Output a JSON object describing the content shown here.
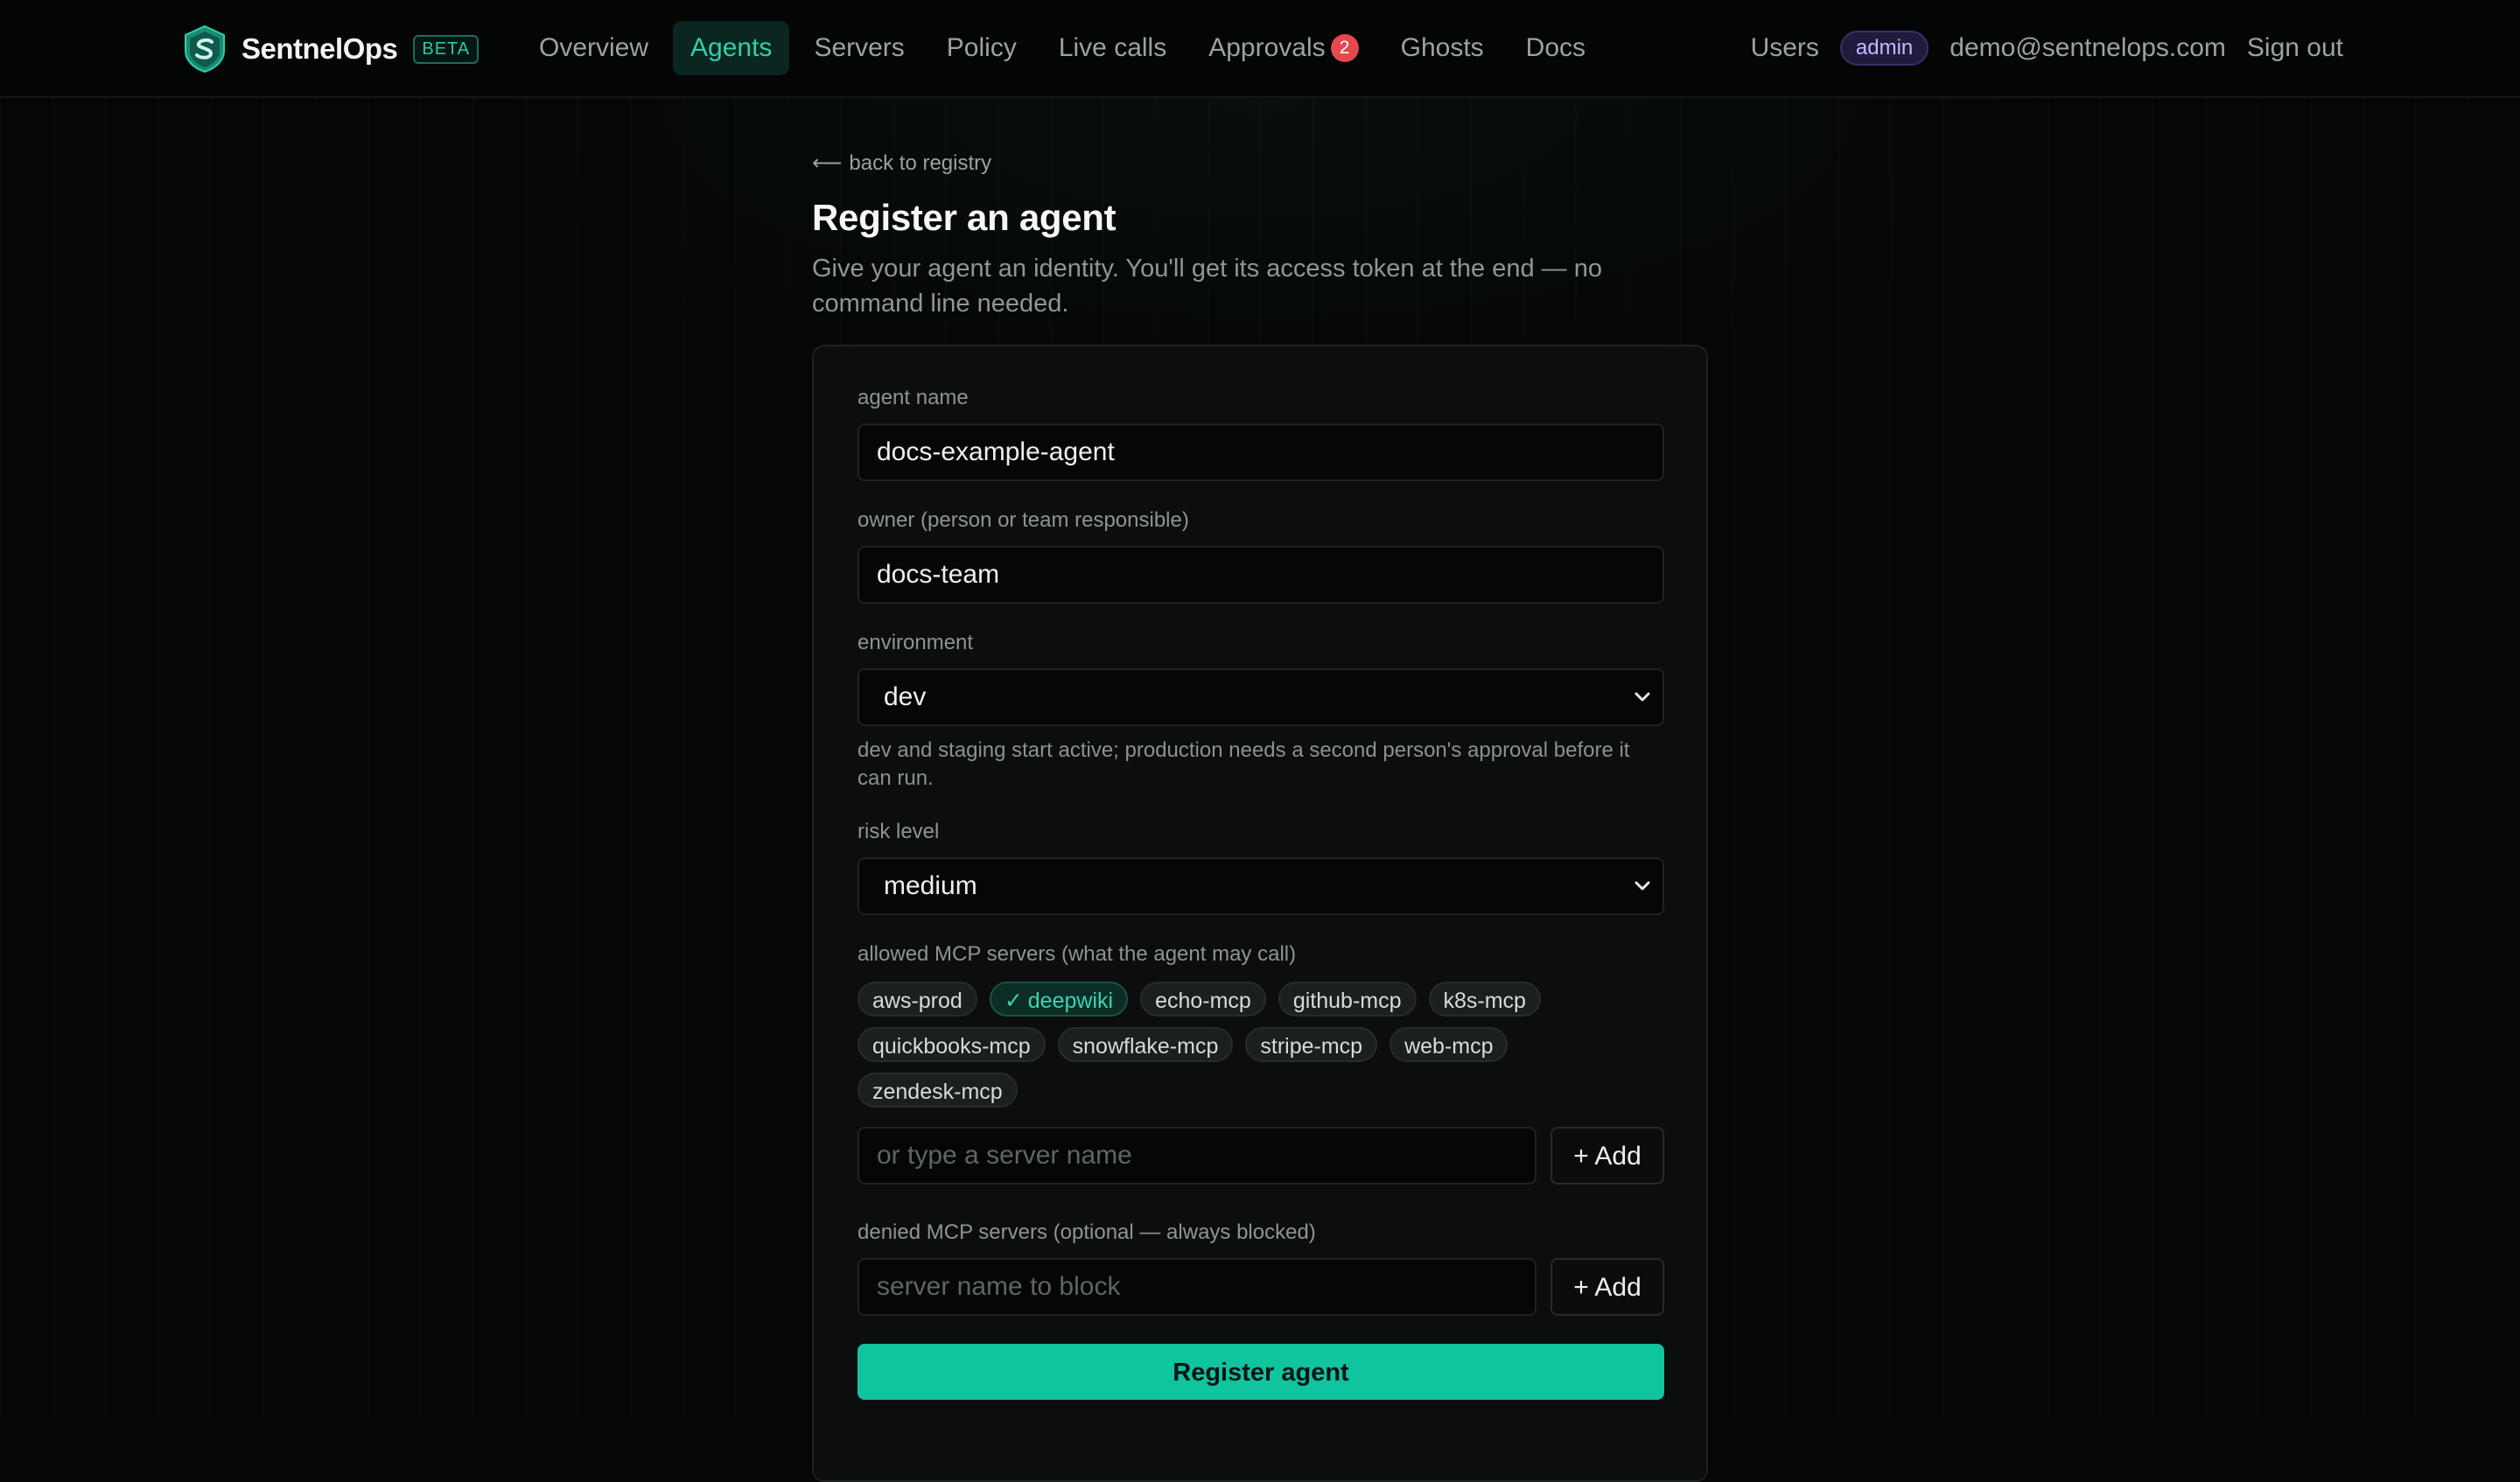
{
  "header": {
    "brand_name": "SentnelOps",
    "beta_label": "BETA",
    "nav": [
      {
        "label": "Overview"
      },
      {
        "label": "Agents",
        "active": true
      },
      {
        "label": "Servers"
      },
      {
        "label": "Policy"
      },
      {
        "label": "Live calls"
      },
      {
        "label": "Approvals",
        "badge": "2"
      },
      {
        "label": "Ghosts"
      },
      {
        "label": "Docs"
      }
    ],
    "users_label": "Users",
    "role_badge": "admin",
    "user_email": "demo@sentnelops.com",
    "sign_out_label": "Sign out"
  },
  "page": {
    "back_label": "back to registry",
    "title": "Register an agent",
    "subtitle": "Give your agent an identity. You'll get its access token at the end — no command line needed."
  },
  "form": {
    "agent_name": {
      "label": "agent name",
      "value": "docs-example-agent"
    },
    "owner": {
      "label": "owner (person or team responsible)",
      "value": "docs-team"
    },
    "environment": {
      "label": "environment",
      "value": "dev",
      "help": "dev and staging start active; production needs a second person's approval before it can run."
    },
    "risk_level": {
      "label": "risk level",
      "value": "medium"
    },
    "allowed_servers": {
      "label": "allowed MCP servers (what the agent may call)",
      "servers": [
        "aws-prod",
        "deepwiki",
        "echo-mcp",
        "github-mcp",
        "k8s-mcp",
        "quickbooks-mcp",
        "snowflake-mcp",
        "stripe-mcp",
        "web-mcp",
        "zendesk-mcp"
      ],
      "selected": [
        "deepwiki"
      ],
      "check_glyph": "✓",
      "input_placeholder": "or type a server name",
      "add_label": "+ Add"
    },
    "denied_servers": {
      "label": "denied MCP servers (optional — always blocked)",
      "input_placeholder": "server name to block",
      "add_label": "+ Add"
    },
    "submit_label": "Register agent"
  },
  "colors": {
    "accent": "#10c4a0",
    "accent_text": "#2fd0ab",
    "badge_red": "#e5484d",
    "admin_purple": "#c8b8ff"
  },
  "icons": {
    "logo": "shield-s-logo-icon",
    "back": "arrow-left-icon",
    "select": "chevron-down-icon",
    "selected_chip": "check-icon"
  }
}
